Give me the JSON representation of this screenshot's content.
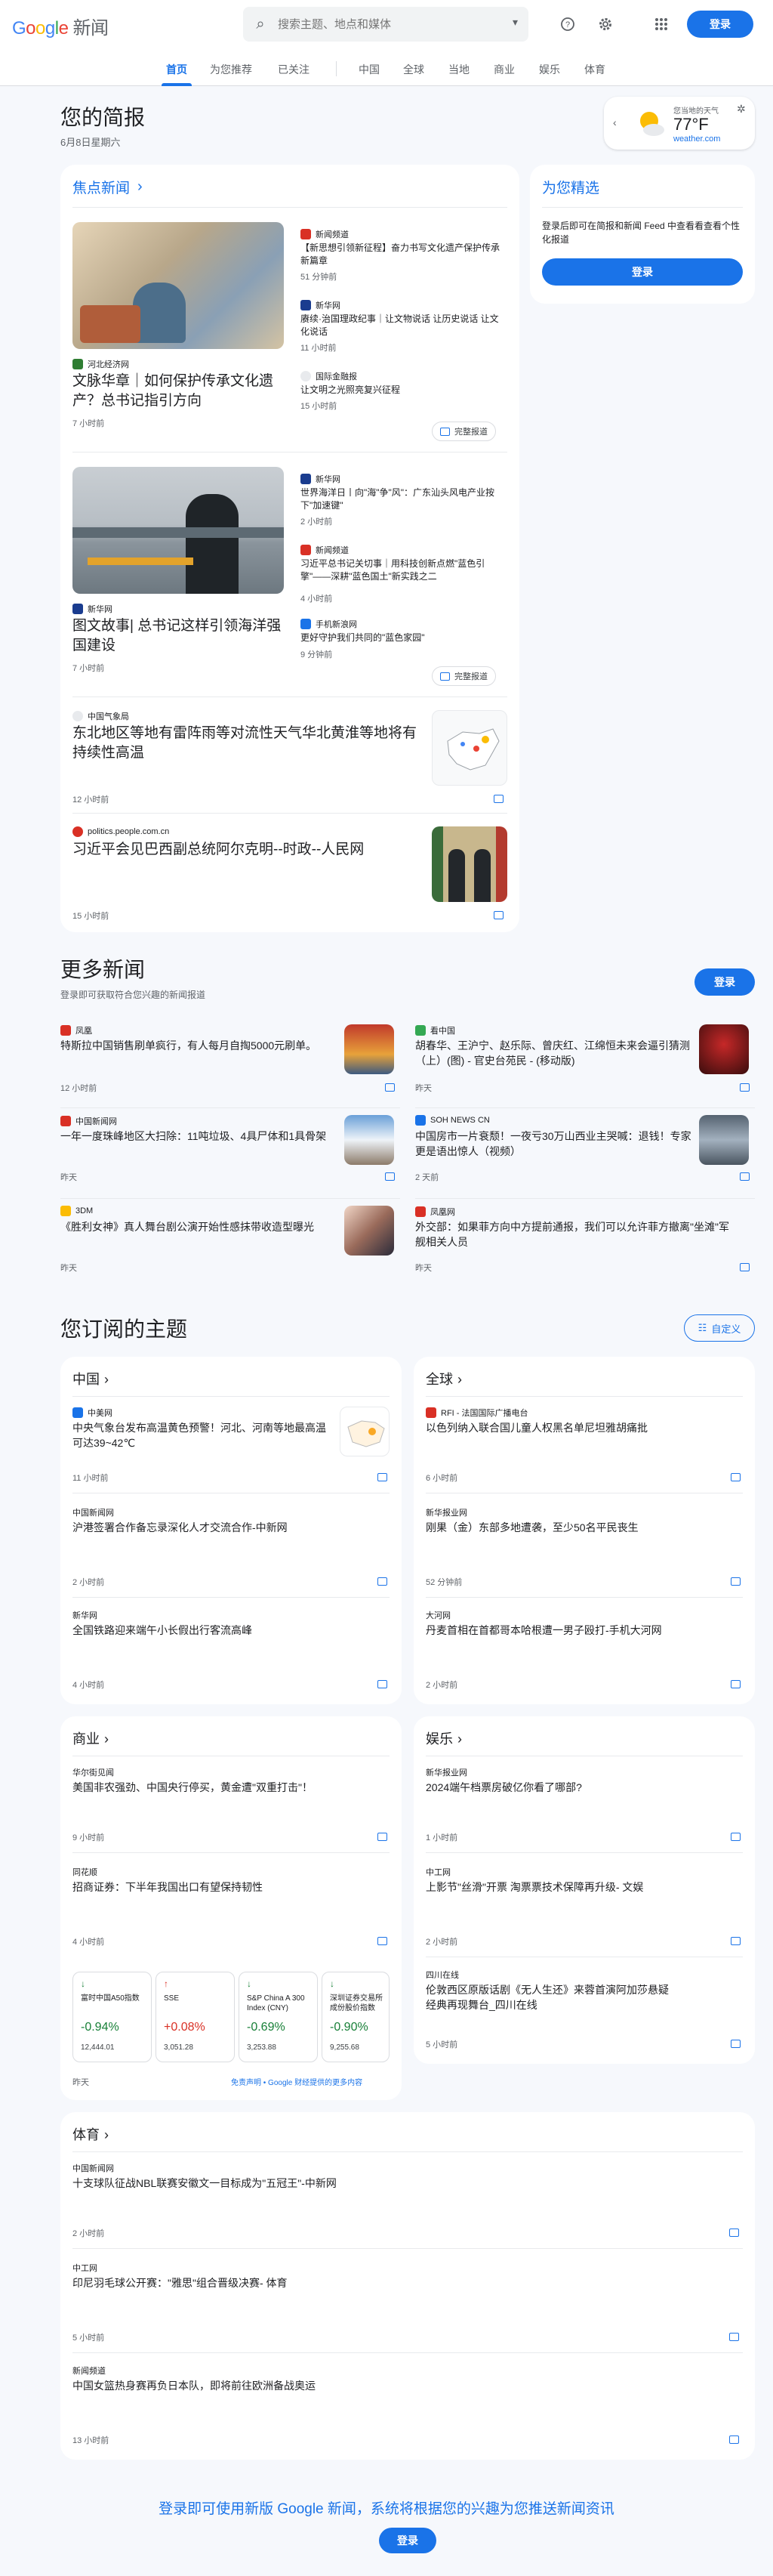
{
  "header": {
    "logo_google": "Google",
    "logo_news": "新闻",
    "search_placeholder": "搜索主题、地点和媒体",
    "login": "登录"
  },
  "colors": {
    "accent": "#1a73e8",
    "down": "#188038",
    "up": "#d93025"
  },
  "icons": [
    "search-icon",
    "chevron-down-icon",
    "help-icon",
    "gear-icon",
    "apps-icon",
    "full-coverage-icon",
    "chevron-right-icon",
    "customize-icon"
  ],
  "tabs": [
    "首页",
    "为您推荐",
    "已关注",
    "中国",
    "全球",
    "当地",
    "商业",
    "娱乐",
    "体育"
  ],
  "brief": {
    "title": "您的简报",
    "date": "6月8日星期六"
  },
  "weather": {
    "label": "您当地的天气",
    "temp": "77°F",
    "source": "weather.com"
  },
  "top_stories": {
    "heading": "焦点新闻",
    "clusters": [
      {
        "main": {
          "source": "河北经济网",
          "title": "文脉华章｜如何保护传承文化遗产？总书记指引方向",
          "time": "7 小时前"
        },
        "side": [
          {
            "source": "新闻频道",
            "title": "【新思想引领新征程】奋力书写文化遗产保护传承新篇章",
            "time": "51 分钟前"
          },
          {
            "source": "新华网",
            "title": "赓续·治国理政纪事｜让文物说话 让历史说话 让文化说话",
            "time": "11 小时前"
          },
          {
            "source": "国际金融报",
            "title": "让文明之光照亮复兴征程",
            "time": "15 小时前"
          }
        ],
        "cov": "完整报道"
      },
      {
        "main": {
          "source": "新华网",
          "title": "图文故事| 总书记这样引领海洋强国建设",
          "time": "7 小时前"
        },
        "side": [
          {
            "source": "新华网",
            "title": "世界海洋日丨向\"海\"争\"风\"：广东汕头风电产业按下\"加速键\"",
            "time": "2 小时前"
          },
          {
            "source": "新闻频道",
            "title": "习近平总书记关切事｜用科技创新点燃\"蓝色引擎\"——深耕\"蓝色国土\"新实践之二",
            "time": "4 小时前"
          },
          {
            "source": "手机新浪网",
            "title": "更好守护我们共同的\"蓝色家园\"",
            "time": "9 分钟前"
          }
        ],
        "cov": "完整报道"
      },
      {
        "main": {
          "source": "中国气象局",
          "title": "东北地区等地有雷阵雨等对流性天气华北黄淮等地将有持续性高温",
          "time": "12 小时前"
        }
      },
      {
        "main": {
          "source": "politics.people.com.cn",
          "title": "习近平会见巴西副总统阿尔克明--时政--人民网",
          "time": "15 小时前"
        }
      }
    ]
  },
  "for_you": {
    "title": "为您精选",
    "text": "登录后即可在简报和新闻 Feed 中查看看查看个性化报道",
    "login": "登录"
  },
  "more": {
    "title": "更多新闻",
    "subtitle": "登录即可获取符合您兴趣的新闻报道",
    "login": "登录",
    "items": [
      {
        "source": "凤凰",
        "title": "特斯拉中国销售刷单疯行，有人每月自掏5000元刷单。",
        "time": "12 小时前"
      },
      {
        "source": "看中国",
        "title": "胡春华、王沪宁、赵乐际、曾庆红、江绵恒未来会逼引猜测（上）(图) - 官史台苑民 - (移动版)",
        "time": "昨天"
      },
      {
        "source": "中国新闻网",
        "title": "一年一度珠峰地区大扫除：11吨垃圾、4具尸体和1具骨架",
        "time": "昨天"
      },
      {
        "source": "SOH NEWS CN",
        "title": "中国房市一片衰颓！一夜亏30万山西业主哭喊：退钱！专家更是语出惊人（视频）",
        "time": "2 天前"
      },
      {
        "source": "3DM",
        "title": "《胜利女神》真人舞台剧公演开始性感抹带收造型曝光",
        "time": "昨天"
      },
      {
        "source": "凤凰网",
        "title": "外交部：如果菲方向中方提前通报，我们可以允许菲方撤离\"坐滩\"军舰相关人员",
        "time": "昨天"
      }
    ]
  },
  "topics": {
    "title": "您订阅的主题",
    "customize": "自定义",
    "china": {
      "name": "中国",
      "items": [
        {
          "source": "中美网",
          "title": "中央气象台发布高温黄色预警！河北、河南等地最高温可达39~42℃",
          "time": "11 小时前"
        },
        {
          "source": "中国新闻网",
          "title": "沪港签署合作备忘录深化人才交流合作-中新网",
          "time": "2 小时前"
        },
        {
          "source": "新华网",
          "title": "全国铁路迎来端午小长假出行客流高峰",
          "time": "4 小时前"
        }
      ]
    },
    "world": {
      "name": "全球",
      "items": [
        {
          "source": "RFI - 法国国际广播电台",
          "title": "以色列纳入联合国儿童人权黑名单尼坦雅胡痛批",
          "time": "6 小时前"
        },
        {
          "source": "新华报业网",
          "title": "刚果（金）东部多地遭袭，至少50名平民丧生",
          "time": "52 分钟前"
        },
        {
          "source": "大河网",
          "title": "丹麦首相在首都哥本哈根遭一男子殴打-手机大河网",
          "time": "2 小时前"
        }
      ]
    },
    "business": {
      "name": "商业",
      "items": [
        {
          "source": "华尔街见闻",
          "title": "美国非农强劲、中国央行停买，黄金遭\"双重打击\"！",
          "time": "9 小时前"
        },
        {
          "source": "同花顺",
          "title": "招商证券：下半年我国出口有望保持韧性",
          "time": "4 小时前"
        }
      ],
      "stocks": [
        {
          "name": "富时中国A50指数",
          "change": "-0.94%",
          "value": "12,444.01",
          "dir": "down"
        },
        {
          "name": "SSE",
          "change": "+0.08%",
          "value": "3,051.28",
          "dir": "up"
        },
        {
          "name": "S&P China A 300 Index (CNY)",
          "change": "-0.69%",
          "value": "3,253.88",
          "dir": "down"
        },
        {
          "name": "深圳证券交易所成份股价指数",
          "change": "-0.90%",
          "value": "9,255.68",
          "dir": "down"
        }
      ],
      "stock_time": "昨天",
      "disclaimer": "免责声明 • Google 财经提供的更多内容"
    },
    "ent": {
      "name": "娱乐",
      "items": [
        {
          "source": "新华报业网",
          "title": "2024端午档票房破亿你看了哪部?",
          "time": "1 小时前"
        },
        {
          "source": "中工网",
          "title": "上影节\"丝滑\"开票 淘票票技术保障再升级- 文娱",
          "time": "2 小时前"
        },
        {
          "source": "四川在线",
          "title": "伦敦西区原版话剧《无人生还》来蓉首演阿加莎悬疑经典再现舞台_四川在线",
          "time": "5 小时前"
        }
      ]
    },
    "sports": {
      "name": "体育",
      "items": [
        {
          "source": "中国新闻网",
          "title": "十支球队征战NBL联赛安徽文一目标成为\"五冠王\"-中新网",
          "time": "2 小时前"
        },
        {
          "source": "中工网",
          "title": "印尼羽毛球公开赛：\"雅思\"组合晋级决赛- 体育",
          "time": "5 小时前"
        },
        {
          "source": "新闻频道",
          "title": "中国女篮热身赛再负日本队，即将前往欧洲备战奥运",
          "time": "13 小时前"
        }
      ]
    }
  },
  "footer": {
    "text": "登录即可使用新版 Google 新闻，系统将根据您的兴趣为您推送新闻资讯",
    "login": "登录"
  }
}
